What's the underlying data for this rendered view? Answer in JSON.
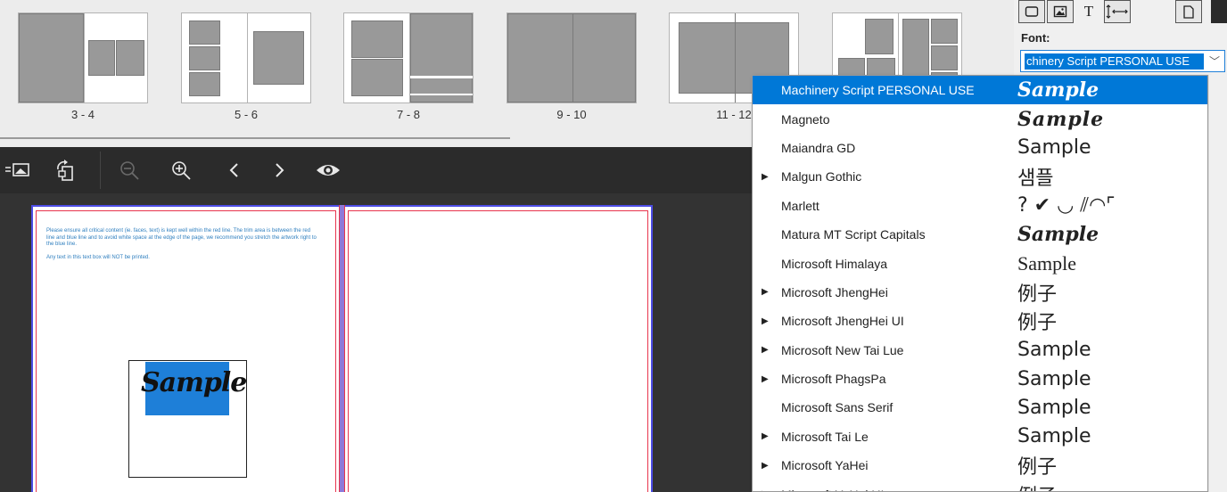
{
  "spreads": [
    {
      "label": "3 - 4"
    },
    {
      "label": "5 - 6"
    },
    {
      "label": "7 - 8"
    },
    {
      "label": "9 - 10"
    },
    {
      "label": "11 - 12"
    }
  ],
  "toolbar": {
    "icons": [
      "photo-list-icon",
      "rotate-page-icon",
      "zoom-out-icon",
      "zoom-in-icon",
      "previous-page-icon",
      "next-page-icon",
      "preview-eye-icon"
    ]
  },
  "page_note": {
    "line1": "Please ensure all critical content (ie. faces, text) is kept well within the red line. The trim area is between the red line and blue line and to avoid white space at the edge of the page, we recommend you stretch the artwork right to the blue line.",
    "line2": "Any text in this text box will NOT be printed."
  },
  "text_box": {
    "sample": "Sample"
  },
  "panel": {
    "tabs": [
      "frame-tab-icon",
      "image-tab-icon",
      "T",
      "spacing-tab-icon",
      "page-tab-icon"
    ],
    "font_label": "Font:",
    "font_value": "Machinery Script PERSONAL USE",
    "font_value_visible": "chinery Script PERSONAL USE"
  },
  "font_list": [
    {
      "name": "Machinery Script PERSONAL USE",
      "sample": "Sample",
      "style": "s-script",
      "submenu": false,
      "selected": true
    },
    {
      "name": "Magneto",
      "sample": "Sample",
      "style": "s-black",
      "submenu": false,
      "selected": false
    },
    {
      "name": "Maiandra GD",
      "sample": "Sample",
      "style": "s-sans",
      "submenu": false,
      "selected": false
    },
    {
      "name": "Malgun Gothic",
      "sample": "샘플",
      "style": "s-sans",
      "submenu": true,
      "selected": false
    },
    {
      "name": "Marlett",
      "sample": "? ✔ ◡ ⫽◠⌜",
      "style": "s-sans",
      "submenu": false,
      "selected": false
    },
    {
      "name": "Matura MT Script Capitals",
      "sample": "Sample",
      "style": "s-script",
      "submenu": false,
      "selected": false
    },
    {
      "name": "Microsoft Himalaya",
      "sample": "Sample",
      "style": "s-serif",
      "submenu": false,
      "selected": false
    },
    {
      "name": "Microsoft JhengHei",
      "sample": "例子",
      "style": "s-sans",
      "submenu": true,
      "selected": false
    },
    {
      "name": "Microsoft JhengHei UI",
      "sample": "例子",
      "style": "s-sans",
      "submenu": true,
      "selected": false
    },
    {
      "name": "Microsoft New Tai Lue",
      "sample": "Sample",
      "style": "s-sans",
      "submenu": true,
      "selected": false
    },
    {
      "name": "Microsoft PhagsPa",
      "sample": "Sample",
      "style": "s-sans",
      "submenu": true,
      "selected": false
    },
    {
      "name": "Microsoft Sans Serif",
      "sample": "Sample",
      "style": "s-sans",
      "submenu": false,
      "selected": false
    },
    {
      "name": "Microsoft Tai Le",
      "sample": "Sample",
      "style": "s-sans",
      "submenu": true,
      "selected": false
    },
    {
      "name": "Microsoft YaHei",
      "sample": "例子",
      "style": "s-sans",
      "submenu": true,
      "selected": false
    },
    {
      "name": "Microsoft YaHei UI",
      "sample": "例子",
      "style": "s-sans",
      "submenu": true,
      "selected": false
    }
  ]
}
